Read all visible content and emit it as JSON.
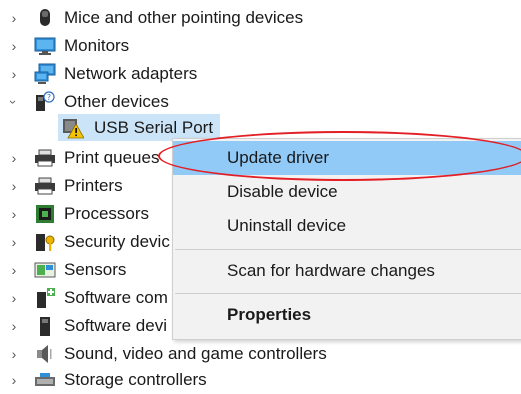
{
  "tree": {
    "items": [
      {
        "label": "Mice and other pointing devices",
        "expanded": false,
        "icon": "mouse-icon"
      },
      {
        "label": "Monitors",
        "expanded": false,
        "icon": "monitor-icon"
      },
      {
        "label": "Network adapters",
        "expanded": false,
        "icon": "network-adapter-icon"
      },
      {
        "label": "Other devices",
        "expanded": true,
        "icon": "other-devices-icon"
      },
      {
        "label": "USB Serial Port",
        "selected": true,
        "icon": "warning-device-icon"
      },
      {
        "label": "Print queues",
        "expanded": false,
        "icon": "printer-icon"
      },
      {
        "label": "Printers",
        "expanded": false,
        "icon": "printer-icon"
      },
      {
        "label": "Processors",
        "expanded": false,
        "icon": "processor-icon"
      },
      {
        "label": "Security devic",
        "expanded": false,
        "icon": "security-device-icon"
      },
      {
        "label": "Sensors",
        "expanded": false,
        "icon": "sensor-icon"
      },
      {
        "label": "Software com",
        "expanded": false,
        "icon": "software-component-icon"
      },
      {
        "label": "Software devi",
        "expanded": false,
        "icon": "software-device-icon"
      },
      {
        "label": "Sound, video and game controllers",
        "expanded": false,
        "icon": "speaker-icon"
      },
      {
        "label": "Storage controllers",
        "expanded": false,
        "icon": "storage-controller-icon"
      }
    ]
  },
  "context_menu": {
    "items": [
      {
        "label": "Update driver",
        "highlighted": true,
        "annotated": true
      },
      {
        "label": "Disable device"
      },
      {
        "label": "Uninstall device"
      },
      {
        "label": "Scan for hardware changes"
      },
      {
        "label": "Properties",
        "bold": true
      }
    ]
  },
  "colors": {
    "menu_background": "#f2f2f2",
    "menu_highlight": "#91c9f7",
    "selection": "#cce4f7",
    "annotation": "#e31e24"
  }
}
